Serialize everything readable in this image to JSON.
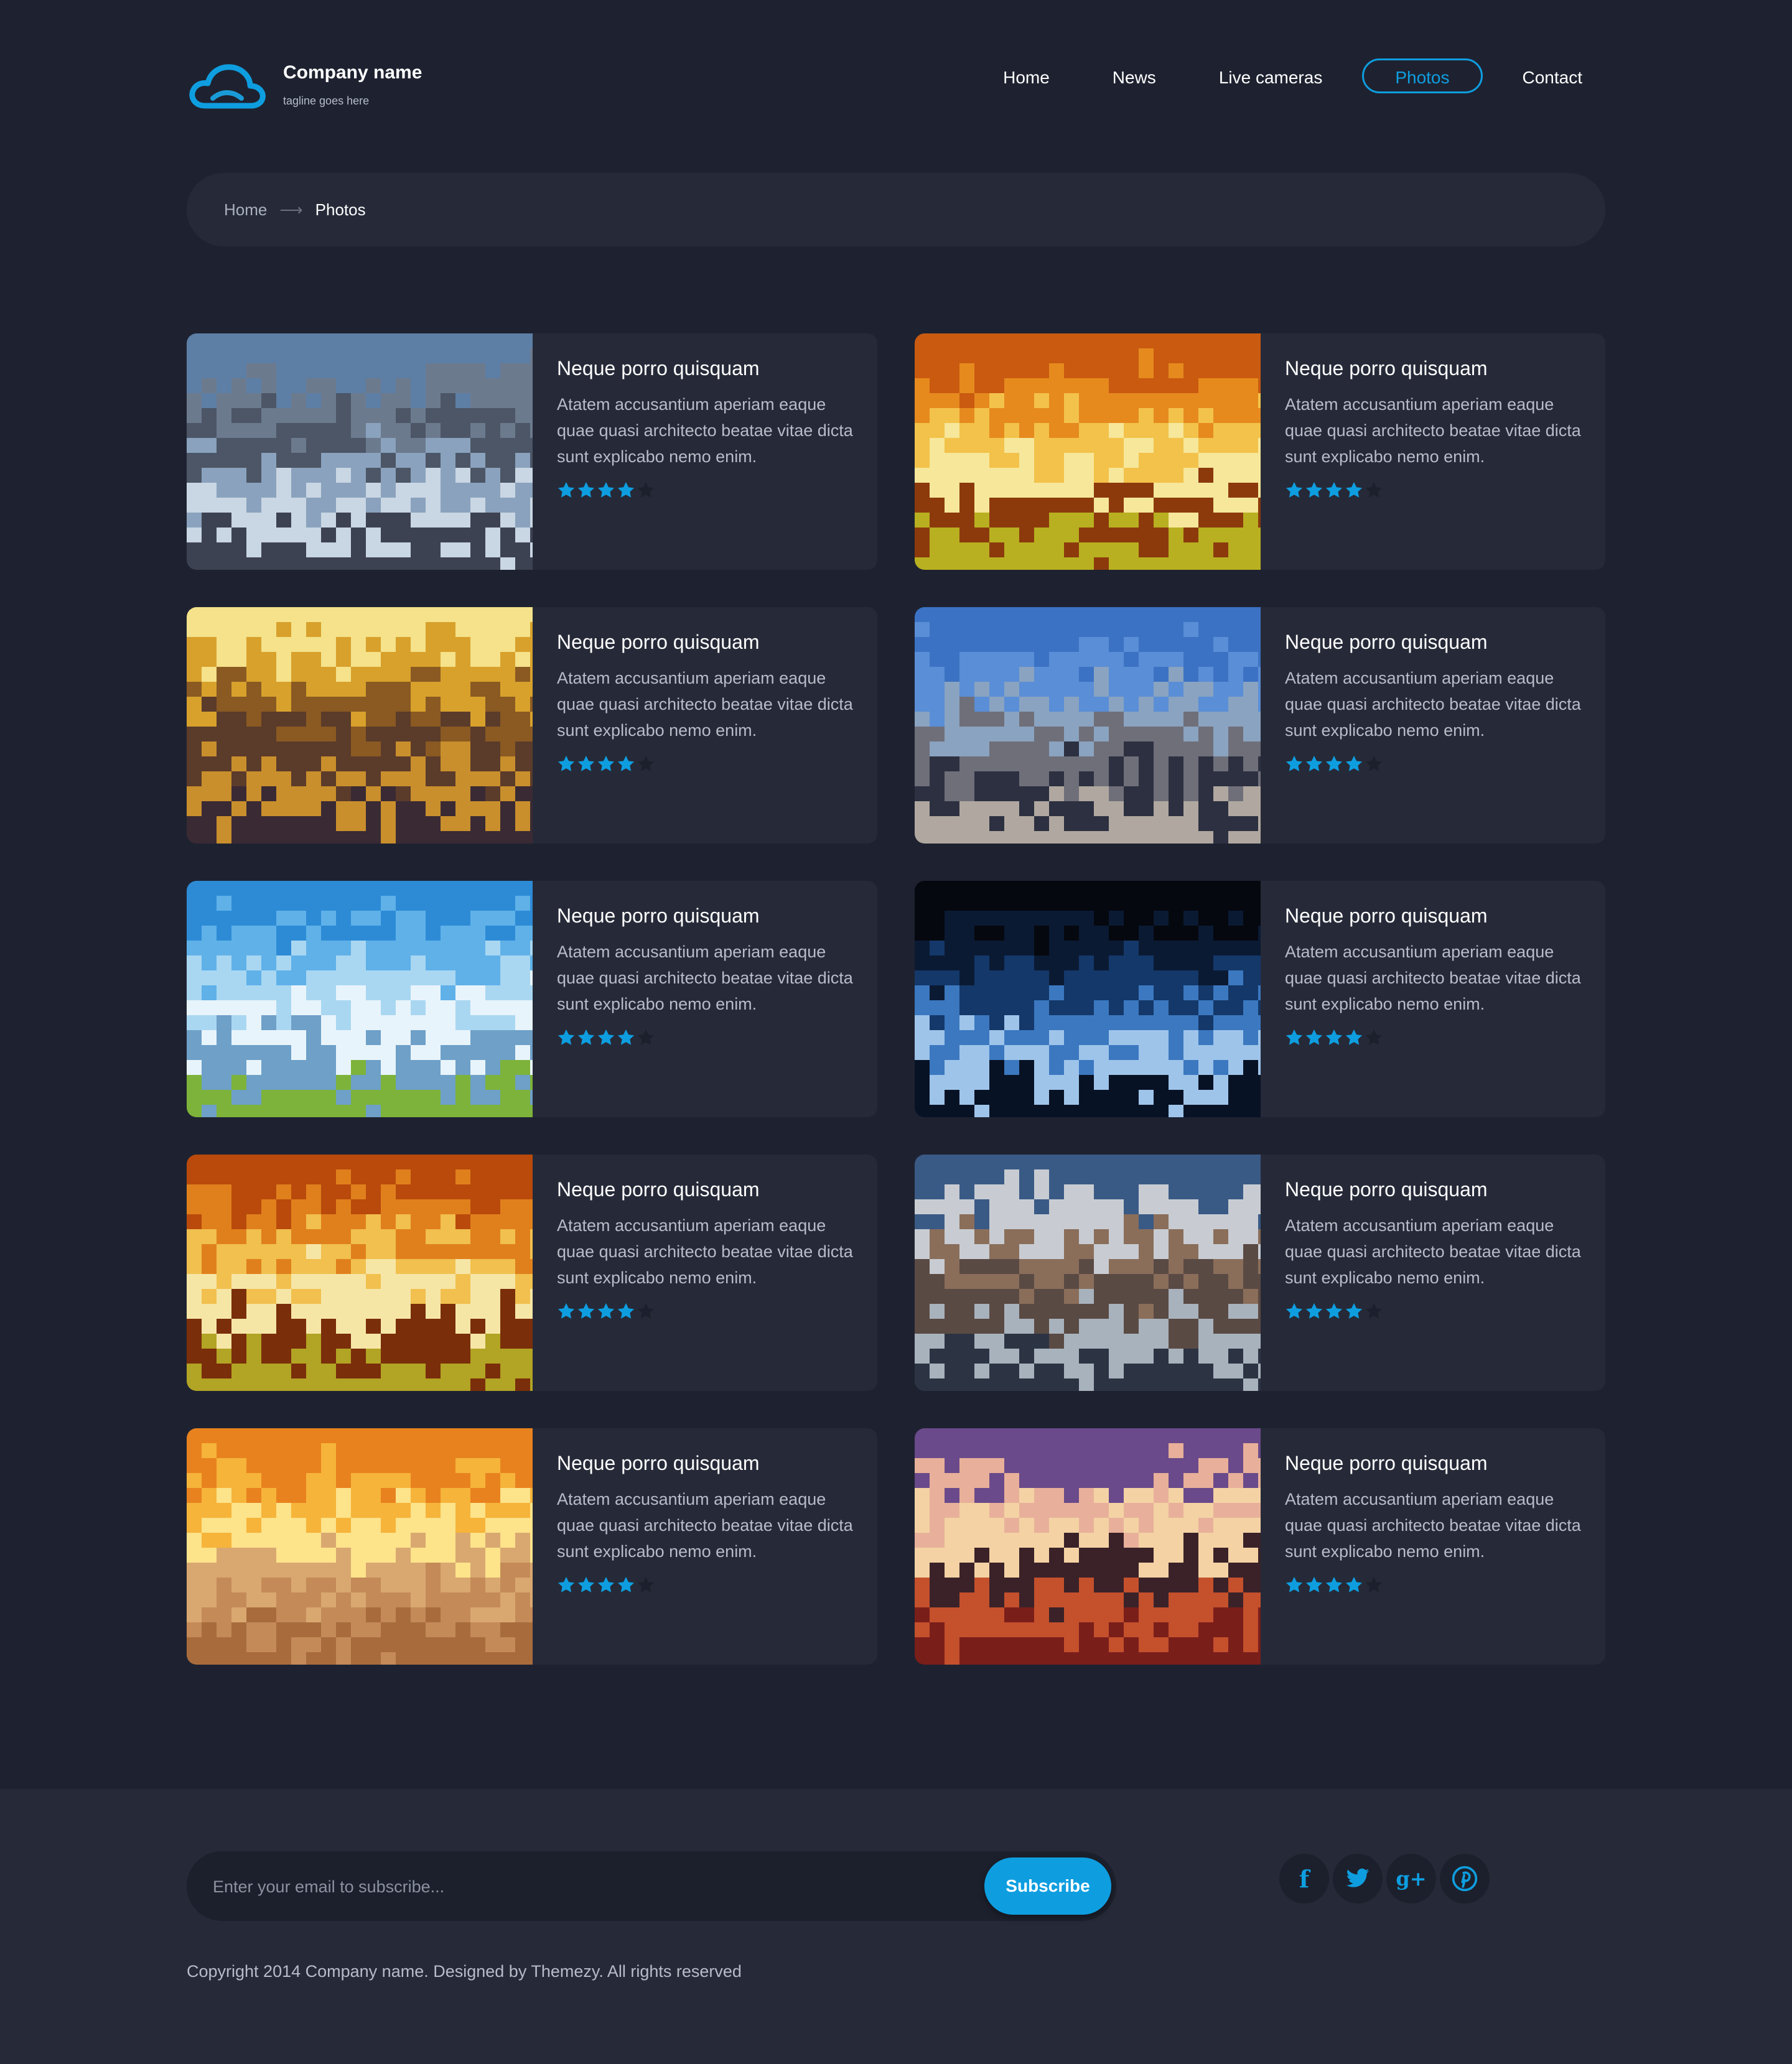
{
  "header": {
    "company_name": "Company name",
    "tagline": "tagline goes here",
    "logo_icon": "cloud-icon",
    "nav": [
      {
        "label": "Home",
        "active": false
      },
      {
        "label": "News",
        "active": false
      },
      {
        "label": "Live cameras",
        "active": false
      },
      {
        "label": "Photos",
        "active": true
      },
      {
        "label": "Contact",
        "active": false
      }
    ]
  },
  "breadcrumb": {
    "home": "Home",
    "separator_icon": "arrow-right-icon",
    "current": "Photos"
  },
  "cards": [
    {
      "title": "Neque porro quisquam",
      "text": "Atatem accusantium aperiam eaque quae quasi architecto beatae vitae dicta sunt explicabo nemo enim.",
      "rating": 4,
      "rating_max": 5,
      "image": "stormy-sky-landscape"
    },
    {
      "title": "Neque porro quisquam",
      "text": "Atatem accusantium aperiam eaque quae quasi architecto beatae vitae dicta sunt explicabo nemo enim.",
      "rating": 4,
      "rating_max": 5,
      "image": "autumn-sunlight"
    },
    {
      "title": "Neque porro quisquam",
      "text": "Atatem accusantium aperiam eaque quae quasi architecto beatae vitae dicta sunt explicabo nemo enim.",
      "rating": 4,
      "rating_max": 5,
      "image": "golden-field-sunset"
    },
    {
      "title": "Neque porro quisquam",
      "text": "Atatem accusantium aperiam eaque quae quasi architecto beatae vitae dicta sunt explicabo nemo enim.",
      "rating": 4,
      "rating_max": 5,
      "image": "tower-bridge"
    },
    {
      "title": "Neque porro quisquam",
      "text": "Atatem accusantium aperiam eaque quae quasi architecto beatae vitae dicta sunt explicabo nemo enim.",
      "rating": 4,
      "rating_max": 5,
      "image": "blue-sky-clouds"
    },
    {
      "title": "Neque porro quisquam",
      "text": "Atatem accusantium aperiam eaque quae quasi architecto beatae vitae dicta sunt explicabo nemo enim.",
      "rating": 4,
      "rating_max": 5,
      "image": "dark-blue-light-streak"
    },
    {
      "title": "Neque porro quisquam",
      "text": "Atatem accusantium aperiam eaque quae quasi architecto beatae vitae dicta sunt explicabo nemo enim.",
      "rating": 4,
      "rating_max": 5,
      "image": "autumn-trees-sun"
    },
    {
      "title": "Neque porro quisquam",
      "text": "Atatem accusantium aperiam eaque quae quasi architecto beatae vitae dicta sunt explicabo nemo enim.",
      "rating": 4,
      "rating_max": 5,
      "image": "city-skyline-reflection"
    },
    {
      "title": "Neque porro quisquam",
      "text": "Atatem accusantium aperiam eaque quae quasi architecto beatae vitae dicta sunt explicabo nemo enim.",
      "rating": 4,
      "rating_max": 5,
      "image": "beach-sunset"
    },
    {
      "title": "Neque porro quisquam",
      "text": "Atatem accusantium aperiam eaque quae quasi architecto beatae vitae dicta sunt explicabo nemo enim.",
      "rating": 4,
      "rating_max": 5,
      "image": "palm-trees-sunset"
    }
  ],
  "footer": {
    "email_placeholder": "Enter your email to subscribe...",
    "subscribe_label": "Subscribe",
    "social": [
      {
        "icon": "facebook-icon",
        "glyph": "f"
      },
      {
        "icon": "twitter-icon",
        "glyph": ""
      },
      {
        "icon": "google-plus-icon",
        "glyph": "g+"
      },
      {
        "icon": "pinterest-icon",
        "glyph": ""
      }
    ],
    "copyright": "Copyright 2014 Company name. Designed by Themezy. All rights reserved"
  },
  "colors": {
    "background": "#1e2230",
    "panel": "#262a38",
    "accent": "#0e9ee0",
    "muted_text": "#b7bcc8"
  }
}
